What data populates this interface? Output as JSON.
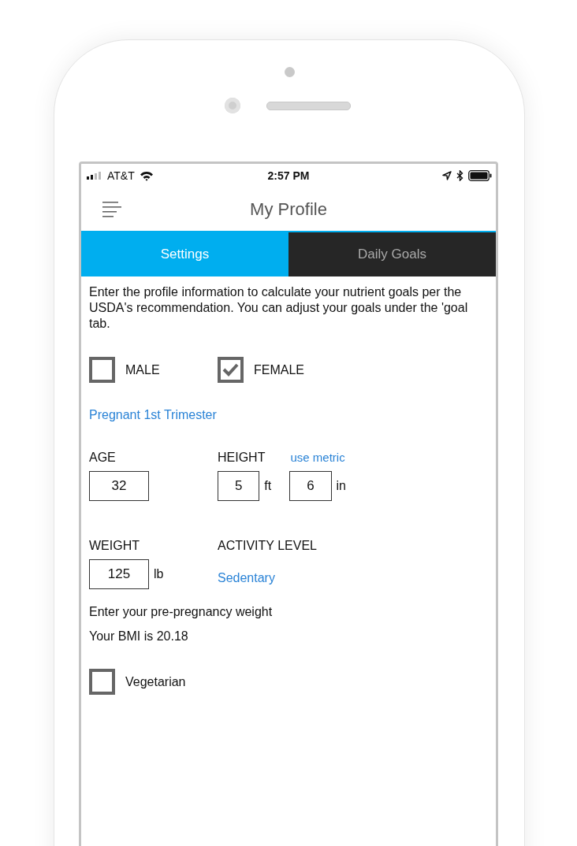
{
  "status_bar": {
    "carrier": "AT&T",
    "time": "2:57 PM"
  },
  "header": {
    "title": "My Profile"
  },
  "tabs": [
    {
      "label": "Settings",
      "selected": true
    },
    {
      "label": "Daily Goals",
      "selected": false
    }
  ],
  "intro_lines": [
    "Enter the profile information to calculate your nutrient goals per the",
    "USDA's recommendation. You can adjust your goals under the 'goal",
    "tab."
  ],
  "gender": [
    {
      "label": "MALE",
      "checked": false
    },
    {
      "label": "FEMALE",
      "checked": true
    }
  ],
  "pregnancy_status": "Pregnant 1st Trimester",
  "age": {
    "label": "AGE",
    "value": "32"
  },
  "height": {
    "label": "HEIGHT",
    "metric_link": "use metric",
    "feet": "5",
    "feet_unit": "ft",
    "inches": "6",
    "inches_unit": "in"
  },
  "weight": {
    "label": "WEIGHT",
    "value": "125",
    "unit": "lb"
  },
  "activity": {
    "label": "ACTIVITY LEVEL",
    "value": "Sedentary"
  },
  "weight_hint": "Enter your pre-pregnancy weight",
  "bmi": "Your BMI is 20.18",
  "vegetarian": {
    "label": "Vegetarian",
    "checked": false
  }
}
